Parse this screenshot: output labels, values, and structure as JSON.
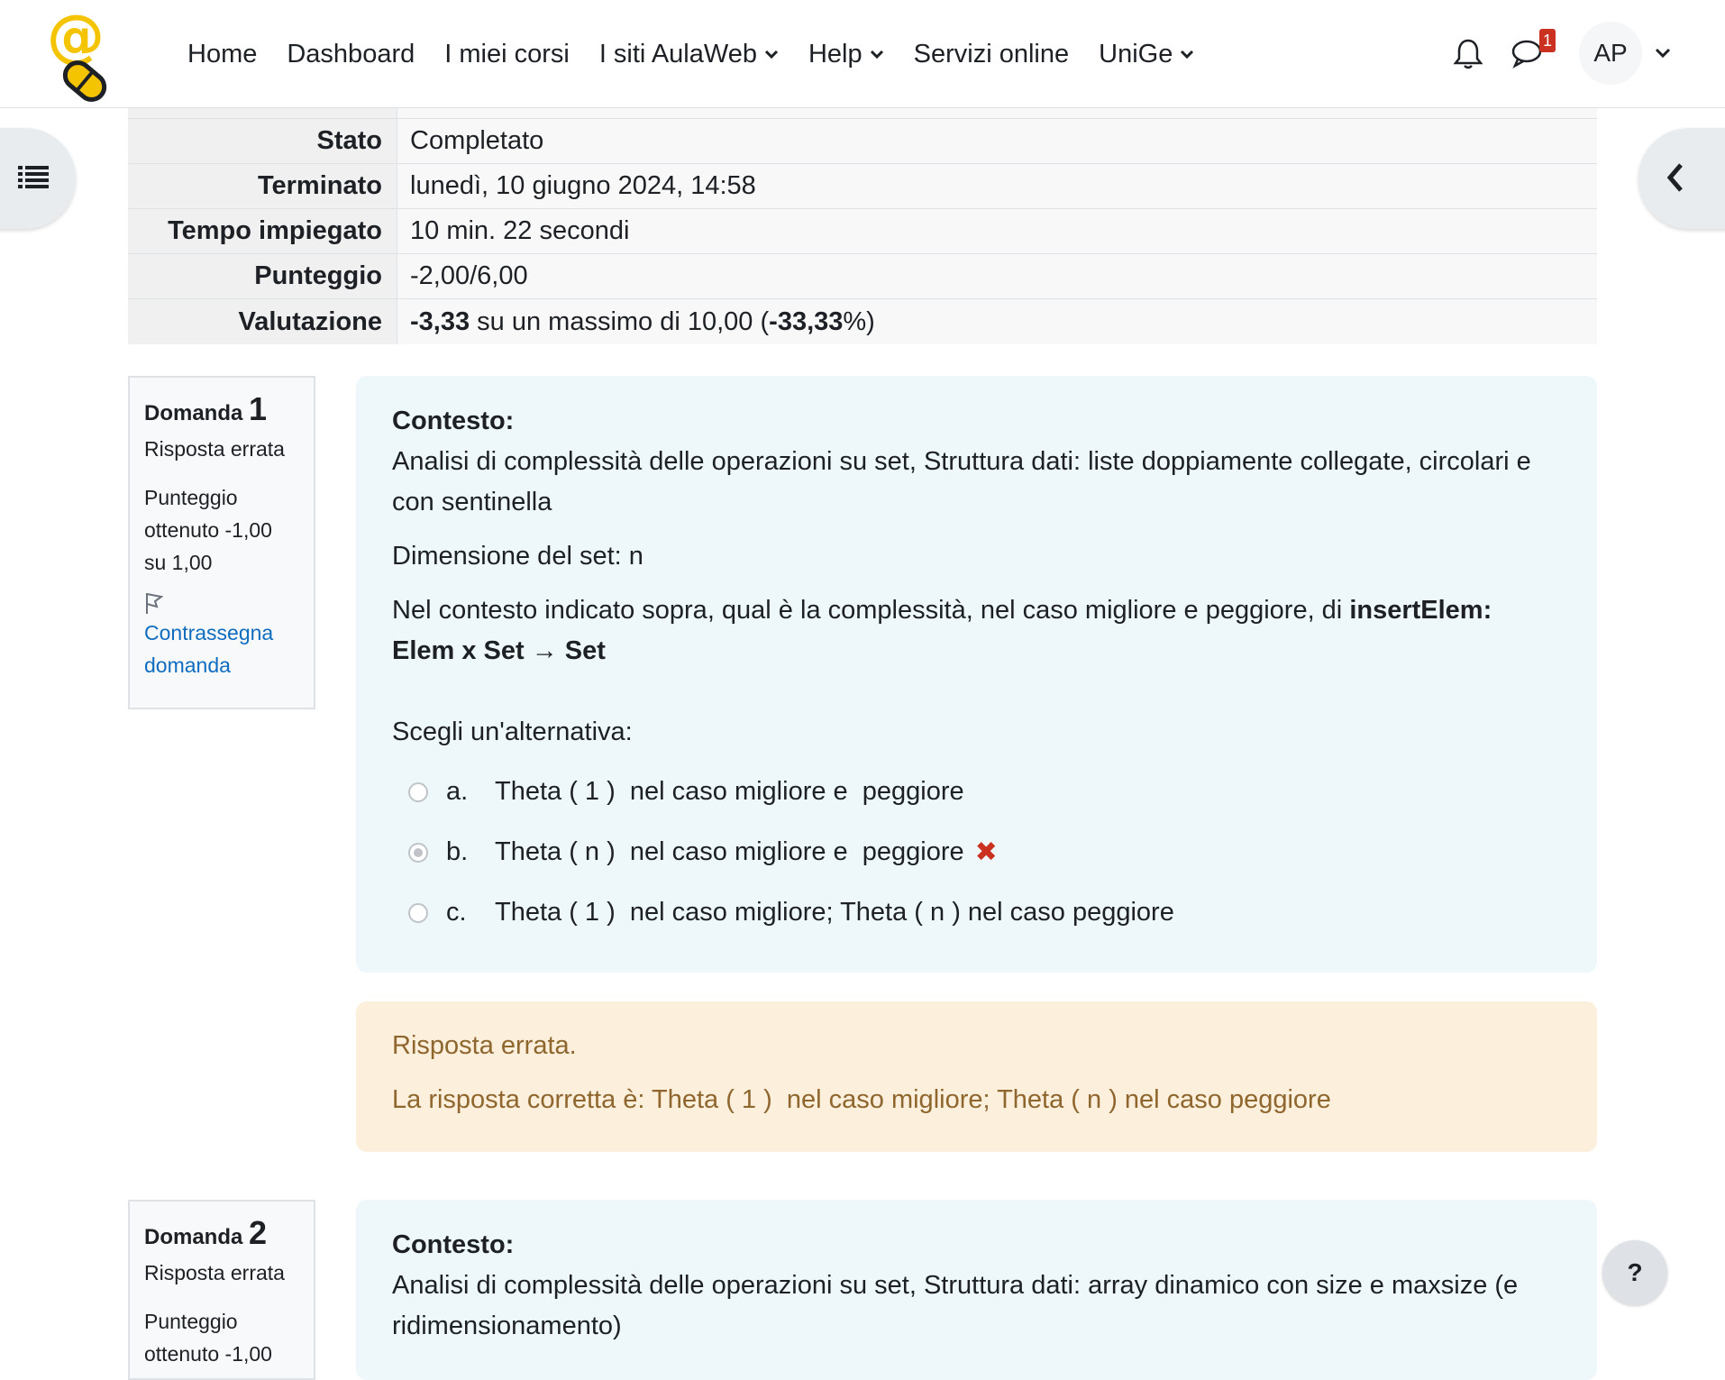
{
  "nav": {
    "items": [
      {
        "label": "Home",
        "dropdown": false
      },
      {
        "label": "Dashboard",
        "dropdown": false
      },
      {
        "label": "I miei corsi",
        "dropdown": false
      },
      {
        "label": "I siti AulaWeb",
        "dropdown": true
      },
      {
        "label": "Help",
        "dropdown": true
      },
      {
        "label": "Servizi online",
        "dropdown": false
      },
      {
        "label": "UniGe",
        "dropdown": true
      }
    ],
    "message_badge": "1",
    "user_initials": "AP"
  },
  "summary": {
    "rows": [
      {
        "label": "Stato",
        "value": "Completato"
      },
      {
        "label": "Terminato",
        "value": "lunedì, 10 giugno 2024, 14:58"
      },
      {
        "label": "Tempo impiegato",
        "value": "10 min. 22 secondi"
      },
      {
        "label": "Punteggio",
        "value": "-2,00/6,00"
      }
    ],
    "valutazione_label": "Valutazione",
    "valutazione_grade": "-3,33",
    "valutazione_mid": " su un massimo di 10,00 (",
    "valutazione_percent": "-33,33",
    "valutazione_end": "%)"
  },
  "questions": [
    {
      "label": "Domanda",
      "number": "1",
      "state": "Risposta errata",
      "grade": "Punteggio ottenuto -1,00 su 1,00",
      "flag": "Contrassegna domanda",
      "context_heading": "Contesto:",
      "context_text": "Analisi di complessità delle operazioni su set, Struttura dati: liste doppiamente collegate, circolari e con sentinella",
      "dimension": "Dimensione del set: n",
      "question_prefix": "Nel contesto indicato sopra, qual è la complessità, nel caso migliore e peggiore, di ",
      "question_bold": "insertElem: Elem x Set → Set",
      "prompt": "Scegli un'alternativa:",
      "answers": [
        {
          "letter": "a.",
          "text": "Theta ( 1 )  nel caso migliore e  peggiore",
          "selected": false
        },
        {
          "letter": "b.",
          "text": "Theta ( n )  nel caso migliore e  peggiore",
          "selected": true,
          "mark": "✖"
        },
        {
          "letter": "c.",
          "text": "Theta ( 1 )  nel caso migliore; Theta ( n ) nel caso peggiore",
          "selected": false
        }
      ],
      "feedback_title": "Risposta errata.",
      "feedback_correct": "La risposta corretta è: Theta ( 1 )  nel caso migliore; Theta ( n ) nel caso peggiore"
    },
    {
      "label": "Domanda",
      "number": "2",
      "state": "Risposta errata",
      "grade": "Punteggio ottenuto -1,00",
      "context_heading": "Contesto:",
      "context_text": "Analisi di complessità delle operazioni su set, Struttura dati: array dinamico con size e maxsize (e ridimensionamento)"
    }
  ],
  "help_label": "?",
  "colors": {
    "feedback_text": "#8e662e",
    "feedback_bg": "#fcefdc",
    "question_bg": "#eef7fa",
    "link": "#0f6cbf",
    "error": "#ca3120"
  }
}
